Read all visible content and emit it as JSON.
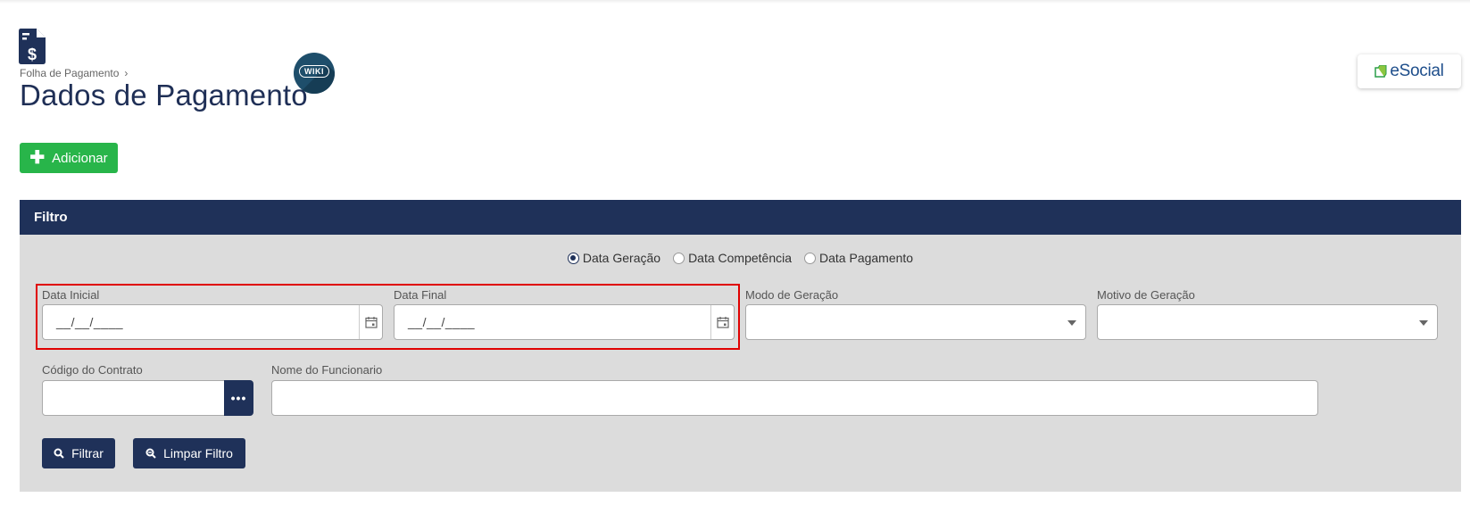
{
  "header": {
    "breadcrumb": "Folha de Pagamento",
    "breadcrumb_sep": "›",
    "title": "Dados de Pagamento",
    "wiki_label": "WIKI",
    "esocial_label": "eSocial"
  },
  "toolbar": {
    "add_label": "Adicionar"
  },
  "filter": {
    "title": "Filtro",
    "radios": [
      {
        "label": "Data Geração",
        "checked": true
      },
      {
        "label": "Data Competência",
        "checked": false
      },
      {
        "label": "Data Pagamento",
        "checked": false
      }
    ],
    "fields": {
      "data_inicial_label": "Data Inicial",
      "data_inicial_value": "__/__/____",
      "data_final_label": "Data Final",
      "data_final_value": "__/__/____",
      "modo_label": "Modo de Geração",
      "motivo_label": "Motivo de Geração",
      "codigo_label": "Código do Contrato",
      "nome_label": "Nome do Funcionario"
    },
    "ellipsis_label": "•••",
    "filtrar_label": "Filtrar",
    "limpar_label": "Limpar Filtro"
  },
  "colors": {
    "navy": "#1f3159",
    "green": "#28b54a",
    "highlight": "#e00000",
    "panel": "#dcdcdc"
  }
}
